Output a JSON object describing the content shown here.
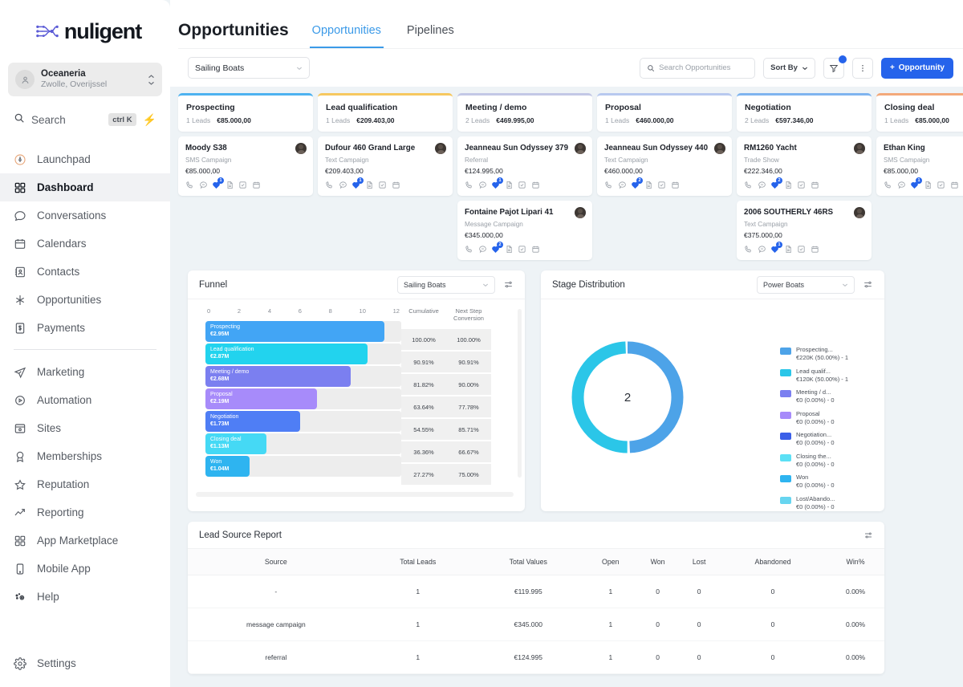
{
  "brand": {
    "name": "nuligent",
    "logo_icon": "circuit-node-logo"
  },
  "sidebar": {
    "workspace": {
      "name": "Oceaneria",
      "location": "Zwolle, Overijssel"
    },
    "search": {
      "label": "Search",
      "shortcut": "ctrl K"
    },
    "items_top": [
      {
        "label": "Launchpad",
        "icon": "rocket-icon",
        "active": false
      },
      {
        "label": "Dashboard",
        "icon": "grid-icon",
        "active": true
      },
      {
        "label": "Conversations",
        "icon": "chat-icon",
        "active": false
      },
      {
        "label": "Calendars",
        "icon": "calendar-icon",
        "active": false
      },
      {
        "label": "Contacts",
        "icon": "contacts-icon",
        "active": false
      },
      {
        "label": "Opportunities",
        "icon": "opportunities-icon",
        "active": false
      },
      {
        "label": "Payments",
        "icon": "payments-icon",
        "active": false
      }
    ],
    "items_mid": [
      {
        "label": "Marketing",
        "icon": "send-icon"
      },
      {
        "label": "Automation",
        "icon": "play-circle-icon"
      },
      {
        "label": "Sites",
        "icon": "browser-icon"
      },
      {
        "label": "Memberships",
        "icon": "badge-icon"
      },
      {
        "label": "Reputation",
        "icon": "star-icon"
      },
      {
        "label": "Reporting",
        "icon": "trend-up-icon"
      },
      {
        "label": "App Marketplace",
        "icon": "apps-grid-icon"
      },
      {
        "label": "Mobile App",
        "icon": "phone-icon"
      },
      {
        "label": "Help",
        "icon": "help-gear-icon"
      }
    ],
    "items_bottom": [
      {
        "label": "Settings",
        "icon": "gear-icon"
      }
    ]
  },
  "header": {
    "page_title": "Opportunities",
    "tabs": [
      {
        "label": "Opportunities",
        "active": true
      },
      {
        "label": "Pipelines",
        "active": false
      }
    ]
  },
  "toolbar": {
    "pipeline_selected": "Sailing Boats",
    "search_placeholder": "Search Opportunities",
    "sort_by_label": "Sort By",
    "filter_icon": "funnel-icon",
    "more_icon": "kebab-menu-icon",
    "add_label": "Opportunity",
    "add_icon": "plus-icon"
  },
  "board": {
    "columns": [
      {
        "name": "Prospecting",
        "leads": "1 Leads",
        "value": "€85.000,00",
        "accent": "#4db2f0",
        "cards": [
          {
            "title": "Moody S38",
            "source": "SMS Campaign",
            "amount": "€85.000,00",
            "badge": "1"
          }
        ]
      },
      {
        "name": "Lead qualification",
        "leads": "1 Leads",
        "value": "€209.403,00",
        "accent": "#f6c860",
        "cards": [
          {
            "title": "Dufour 460 Grand Large",
            "source": "Text Campaign",
            "amount": "€209.403,00",
            "badge": "1"
          }
        ]
      },
      {
        "name": "Meeting / demo",
        "leads": "2 Leads",
        "value": "€469.995,00",
        "accent": "#c3c8e6",
        "cards": [
          {
            "title": "Jeanneau Sun Odyssey 379",
            "source": "Referral",
            "amount": "€124.995,00",
            "badge": "1"
          },
          {
            "title": "Fontaine Pajot Lipari 41",
            "source": "Message Campaign",
            "amount": "€345.000,00",
            "badge": "2"
          }
        ]
      },
      {
        "name": "Proposal",
        "leads": "1 Leads",
        "value": "€460.000,00",
        "accent": "#b8c9ef",
        "cards": [
          {
            "title": "Jeanneau Sun Odyssey 440",
            "source": "Text Campaign",
            "amount": "€460.000,00",
            "badge": "2"
          }
        ]
      },
      {
        "name": "Negotiation",
        "leads": "2 Leads",
        "value": "€597.346,00",
        "accent": "#7fb4ef",
        "cards": [
          {
            "title": "RM1260 Yacht",
            "source": "Trade Show",
            "amount": "€222.346,00",
            "badge": "2"
          },
          {
            "title": "2006 SOUTHERLY 46RS",
            "source": "Text Campaign",
            "amount": "€375.000,00",
            "badge": "1"
          }
        ]
      },
      {
        "name": "Closing deal",
        "leads": "1 Leads",
        "value": "€85.000,00",
        "accent": "#f3a97a",
        "cards": [
          {
            "title": "Ethan King",
            "source": "SMS Campaign",
            "amount": "€85.000,00",
            "badge": "1"
          }
        ]
      }
    ],
    "card_icons": [
      "phone-icon",
      "chat-icon",
      "tag-icon",
      "document-icon",
      "task-icon",
      "calendar-icon"
    ]
  },
  "funnel_panel": {
    "title": "Funnel",
    "selected": "Sailing Boats",
    "tool_icon": "settings-sliders-icon"
  },
  "stage_panel": {
    "title": "Stage Distribution",
    "selected": "Power Boats",
    "tool_icon": "settings-sliders-icon",
    "center_value": "2"
  },
  "table_panel": {
    "title": "Lead Source Report",
    "tool_icon": "settings-sliders-icon"
  },
  "chart_data": [
    {
      "type": "bar",
      "title": "Funnel",
      "xlabel": "",
      "ylabel": "",
      "xlim": [
        0,
        12
      ],
      "ticks": [
        "0",
        "2",
        "4",
        "6",
        "8",
        "10",
        "12"
      ],
      "grid": false,
      "legend": "none",
      "extra_columns": [
        "Cumulative",
        "Next Step Conversion"
      ],
      "categories": [
        "Prospecting",
        "Lead qualification",
        "Meeting / demo",
        "Proposal",
        "Negotiation",
        "Closing deal",
        "Won"
      ],
      "values": [
        11,
        10,
        9,
        7,
        6,
        4,
        3
      ],
      "value_labels": [
        "€2.95M",
        "€2.87M",
        "€2.68M",
        "€2.19M",
        "€1.73M",
        "€1.13M",
        "€1.04M"
      ],
      "cumulative": [
        "100.00%",
        "90.91%",
        "81.82%",
        "63.64%",
        "54.55%",
        "36.36%",
        "27.27%"
      ],
      "next_step_conversion": [
        "100.00%",
        "90.91%",
        "90.00%",
        "77.78%",
        "85.71%",
        "66.67%",
        "75.00%"
      ],
      "colors": [
        "#42a5f5",
        "#22d3ee",
        "#7b7ff0",
        "#a78bfa",
        "#4f7ef5",
        "#45d9f5",
        "#2eb4f0"
      ]
    },
    {
      "type": "pie",
      "title": "Stage Distribution",
      "center_label": "2",
      "legend": "right",
      "slices": [
        {
          "label": "Prospecting...",
          "detail": "€220K (50.00%) - 1",
          "value": 50,
          "color": "#4da3e8"
        },
        {
          "label": "Lead qualif...",
          "detail": "€120K (50.00%) - 1",
          "value": 50,
          "color": "#2bc6e8"
        },
        {
          "label": "Meeting / d...",
          "detail": "€0 (0.00%) - 0",
          "value": 0,
          "color": "#7b7ff0"
        },
        {
          "label": "Proposal",
          "detail": "€0 (0.00%) - 0",
          "value": 0,
          "color": "#a78bfa"
        },
        {
          "label": "Negotiation...",
          "detail": "€0 (0.00%) - 0",
          "value": 0,
          "color": "#3b5fe8"
        },
        {
          "label": "Closing the...",
          "detail": "€0 (0.00%) - 0",
          "value": 0,
          "color": "#5ce0f5"
        },
        {
          "label": "Won",
          "detail": "€0 (0.00%) - 0",
          "value": 0,
          "color": "#2eb4f0"
        },
        {
          "label": "Lost/Abando...",
          "detail": "€0 (0.00%) - 0",
          "value": 0,
          "color": "#67d5f0"
        }
      ]
    },
    {
      "type": "table",
      "title": "Lead Source Report",
      "columns": [
        "Source",
        "Total Leads",
        "Total Values",
        "Open",
        "Won",
        "Lost",
        "Abandoned",
        "Win%"
      ],
      "rows": [
        [
          "-",
          "1",
          "€119.995",
          "1",
          "0",
          "0",
          "0",
          "0.00%"
        ],
        [
          "message campaign",
          "1",
          "€345.000",
          "1",
          "0",
          "0",
          "0",
          "0.00%"
        ],
        [
          "referral",
          "1",
          "€124.995",
          "1",
          "0",
          "0",
          "0",
          "0.00%"
        ]
      ]
    }
  ]
}
